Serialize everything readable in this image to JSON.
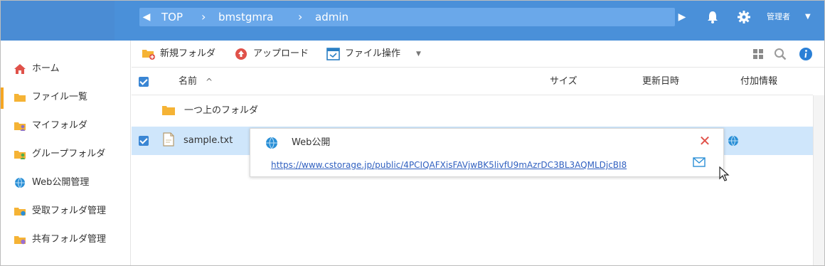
{
  "header": {
    "breadcrumb": [
      "TOP",
      "bmstgmra",
      "admin"
    ],
    "user_name": "管理者",
    "colors": {
      "bar": "#4a90d9",
      "crumb_bg": "#6aa8ea"
    },
    "icons": [
      "chevron-left-icon",
      "chevron-right-icon",
      "bell-icon",
      "gear-icon",
      "caret-down-icon"
    ]
  },
  "sidebar": {
    "items": [
      {
        "label": "ホーム",
        "icon": "home-icon",
        "active": false
      },
      {
        "label": "ファイル一覧",
        "icon": "folder-icon",
        "active": true
      },
      {
        "label": "マイフォルダ",
        "icon": "user-folder-icon",
        "active": false
      },
      {
        "label": "グループフォルダ",
        "icon": "group-folder-icon",
        "active": false
      },
      {
        "label": "Web公開管理",
        "icon": "globe-icon",
        "active": false
      },
      {
        "label": "受取フォルダ管理",
        "icon": "receive-folder-icon",
        "active": false
      },
      {
        "label": "共有フォルダ管理",
        "icon": "share-folder-icon",
        "active": false
      }
    ],
    "accent": "#f5a623"
  },
  "toolbar": {
    "new_folder": "新規フォルダ",
    "upload": "アップロード",
    "file_ops": "ファイル操作",
    "icons": [
      "grid-view-icon",
      "search-icon",
      "info-icon"
    ]
  },
  "table": {
    "columns": {
      "name": "名前",
      "size": "サイズ",
      "updated": "更新日時",
      "extra": "付加情報"
    },
    "sort_indicator": "^",
    "rows": [
      {
        "name": "一つ上のフォルダ",
        "type": "parent-folder",
        "selected": false
      },
      {
        "name": "sample.txt",
        "type": "file",
        "selected": true,
        "extra_icon": "globe-icon"
      }
    ]
  },
  "popup": {
    "title": "Web公開",
    "url": "https://www.cstorage.jp/public/4PCIQAFXisFAVjwBK5livfU9mAzrDC3BL3AQMLDjcBI8"
  }
}
